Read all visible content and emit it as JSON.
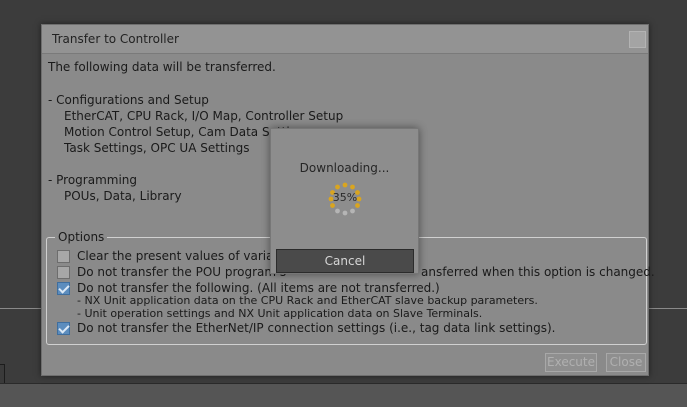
{
  "dialog": {
    "title": "Transfer to Controller",
    "intro": "The following data will be transferred.",
    "sections": [
      {
        "heading": "- Configurations and Setup",
        "items": [
          "EtherCAT, CPU Rack, I/O Map, Controller Setup",
          "Motion Control Setup, Cam Data Settin",
          "Task Settings, OPC UA Settings"
        ]
      },
      {
        "heading": "- Programming",
        "items": [
          "POUs, Data, Library"
        ]
      }
    ],
    "options": {
      "legend": "Options",
      "items": [
        {
          "label": "Clear the present values of variable",
          "checked": false
        },
        {
          "label": "Do not transfer the POU program s",
          "label_tail": "ansferred when this option is changed.",
          "checked": false
        },
        {
          "label": "Do not transfer the following. (All items are not transferred.)",
          "checked": true,
          "sublines": [
            "- NX Unit application data on the CPU Rack and EtherCAT slave backup parameters.",
            "- Unit operation settings and NX Unit application data on Slave Terminals."
          ]
        },
        {
          "label": "Do not transfer the EtherNet/IP connection settings (i.e., tag data link settings).",
          "checked": true
        }
      ]
    },
    "buttons": {
      "execute": "Execute",
      "close": "Close"
    }
  },
  "progress": {
    "message": "Downloading...",
    "percent": "35%",
    "cancel": "Cancel"
  },
  "colors": {
    "background": "#3c3c3c",
    "dialog": "#8a8a8a",
    "checkbox_checked": "#5c8dbe",
    "spinner": "#d9a520"
  }
}
